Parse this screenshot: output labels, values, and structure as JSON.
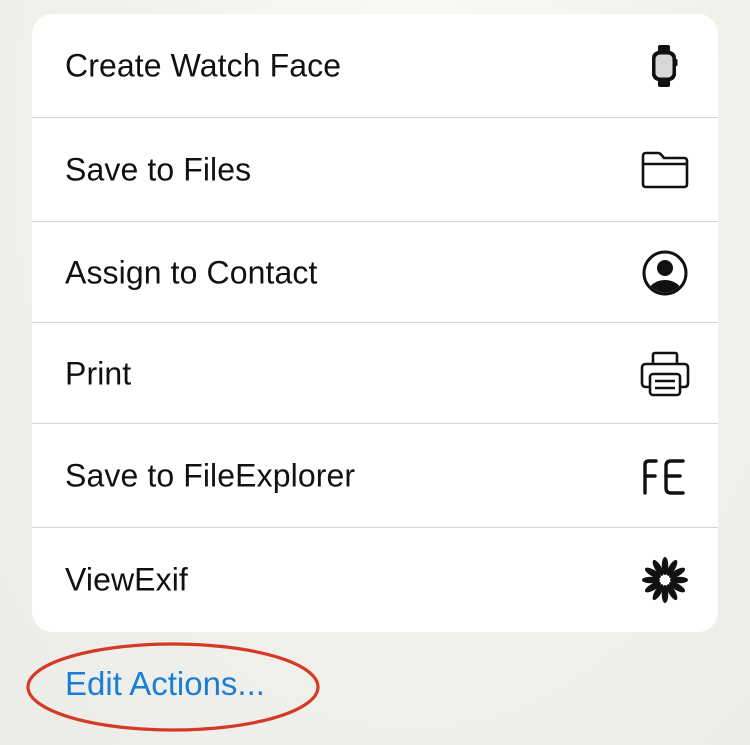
{
  "actions": [
    {
      "label": "Create Watch Face",
      "icon": "watch-icon"
    },
    {
      "label": "Save to Files",
      "icon": "folder-icon"
    },
    {
      "label": "Assign to Contact",
      "icon": "person-circle-icon"
    },
    {
      "label": "Print",
      "icon": "printer-icon"
    },
    {
      "label": "Save to FileExplorer",
      "icon": "fe-app-icon",
      "icon_text": "FE"
    },
    {
      "label": "ViewExif",
      "icon": "asterisk-burst-icon"
    }
  ],
  "edit_actions": {
    "label": "Edit Actions...",
    "color": "#1a7fd4"
  },
  "annotation": {
    "shape": "ellipse",
    "color": "#d63a26"
  }
}
